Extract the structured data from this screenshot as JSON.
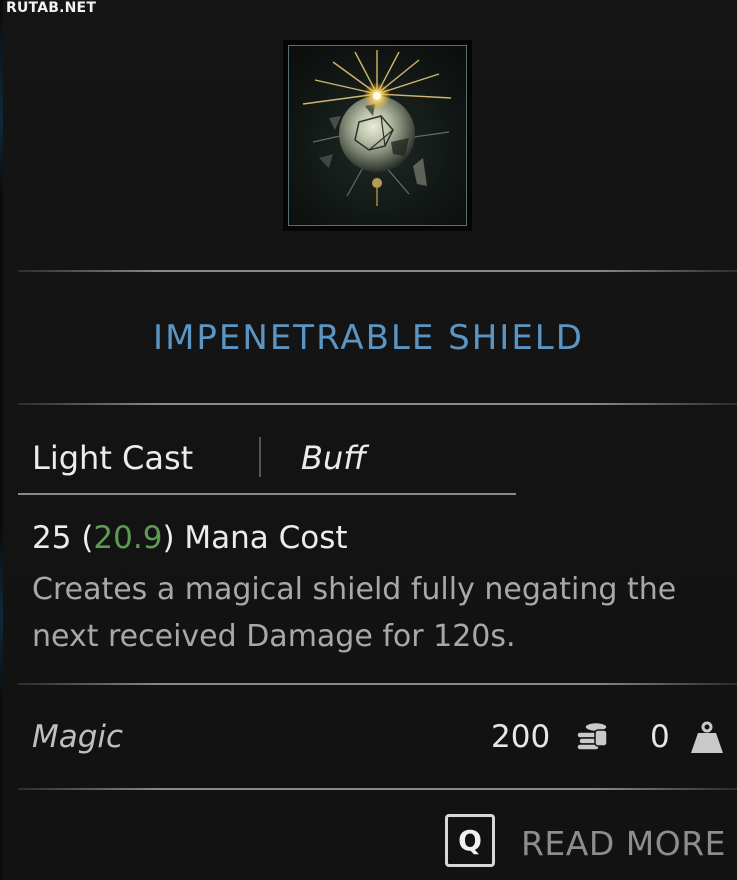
{
  "watermark": "RUTAB.NET",
  "ability": {
    "icon": "shattering-orb-icon",
    "title": "IMPENETRABLE SHIELD",
    "cast_type": "Light Cast",
    "category": "Buff",
    "mana": {
      "base": "25",
      "open_paren": "(",
      "modified": "20.9",
      "close_suffix": ") Mana Cost"
    },
    "description": "Creates a magical shield fully negating the next received Damage for 120s."
  },
  "footer": {
    "school": "Magic",
    "price": "200",
    "price_icon": "coins-icon",
    "weight": "0",
    "weight_icon": "weight-icon"
  },
  "prompt": {
    "key": "Q",
    "label": "READ MORE"
  },
  "colors": {
    "title": "#5b95c4",
    "modified_value": "#5f9a52",
    "background": "#121212"
  }
}
